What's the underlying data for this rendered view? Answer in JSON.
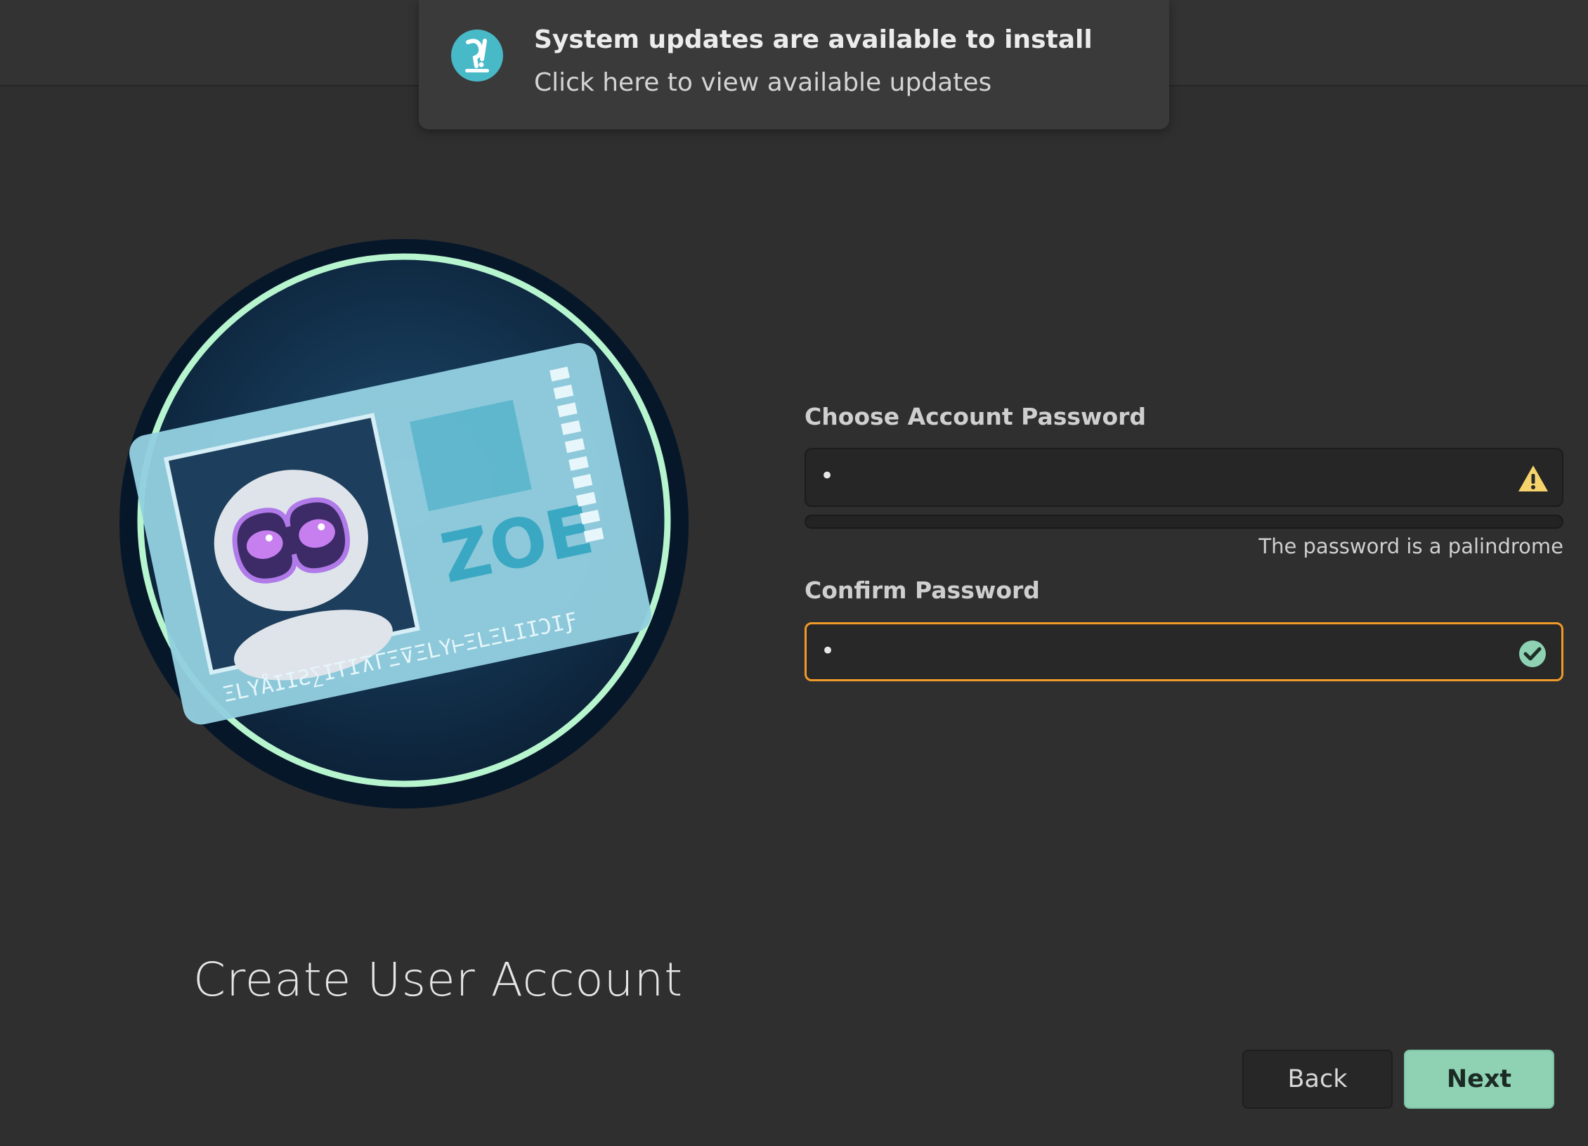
{
  "notification": {
    "title": "System updates are available to install",
    "body": "Click here to view available updates",
    "icon": "pop-os-logo-icon"
  },
  "illustration": {
    "card_text": "ZOE",
    "card_glyphs": "ΞLYÅIIƧ∑ITI⊼ΓΞ⊽ΞLY⊢ΞLΞLIIƆIƑ"
  },
  "page": {
    "title": "Create User Account"
  },
  "password": {
    "label": "Choose Account Password",
    "value": "•",
    "status_icon": "warning-icon",
    "strength_fraction": 0.0,
    "hint": "The password is a palindrome"
  },
  "confirm": {
    "label": "Confirm Password",
    "value": "•",
    "status_icon": "check-circle-icon"
  },
  "buttons": {
    "back": "Back",
    "next": "Next"
  },
  "colors": {
    "background": "#2f2f2f",
    "accent_focus": "#f09a2a",
    "primary_button": "#8ed2b3",
    "warning": "#f6d36b",
    "success": "#8ed2b3",
    "logo_teal": "#48b9c7"
  }
}
